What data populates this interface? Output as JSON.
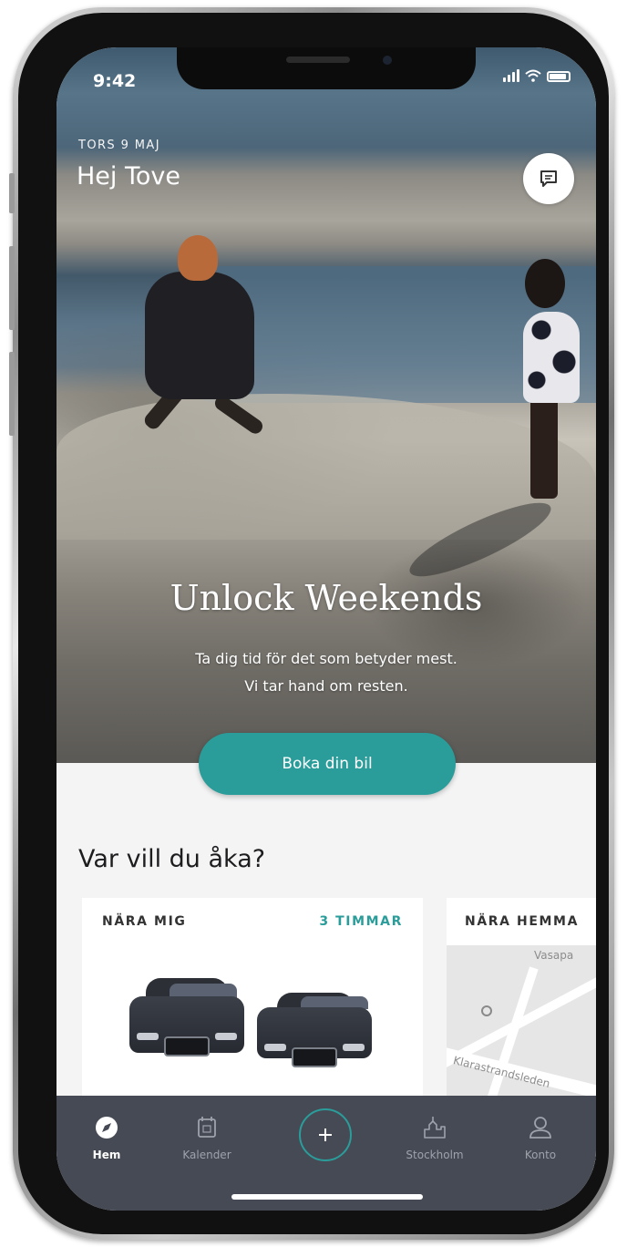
{
  "status_bar": {
    "time": "9:42"
  },
  "header": {
    "date": "TORS 9 MAJ",
    "greeting": "Hej Tove"
  },
  "hero": {
    "headline": "Unlock Weekends",
    "subline_1": "Ta dig tid för det som betyder mest.",
    "subline_2": "Vi tar hand om resten.",
    "cta_label": "Boka din bil"
  },
  "destinations": {
    "title": "Var vill du åka?",
    "cards": [
      {
        "header": "NÄRA MIG",
        "duration": "3 TIMMAR"
      },
      {
        "header": "NÄRA HEMMA",
        "map_labels": [
          "Vasapa",
          "Klarastrandsleden"
        ]
      }
    ]
  },
  "tabbar": {
    "items": [
      {
        "label": "Hem",
        "icon": "compass-icon",
        "active": true
      },
      {
        "label": "Kalender",
        "icon": "calendar-icon",
        "active": false
      },
      {
        "label": "",
        "icon": "plus-icon",
        "active": false
      },
      {
        "label": "Stockholm",
        "icon": "city-icon",
        "active": false
      },
      {
        "label": "Konto",
        "icon": "person-icon",
        "active": false
      }
    ]
  },
  "colors": {
    "accent": "#2a9d9a",
    "tabbar_bg": "#464a55",
    "content_bg": "#f4f4f5"
  }
}
